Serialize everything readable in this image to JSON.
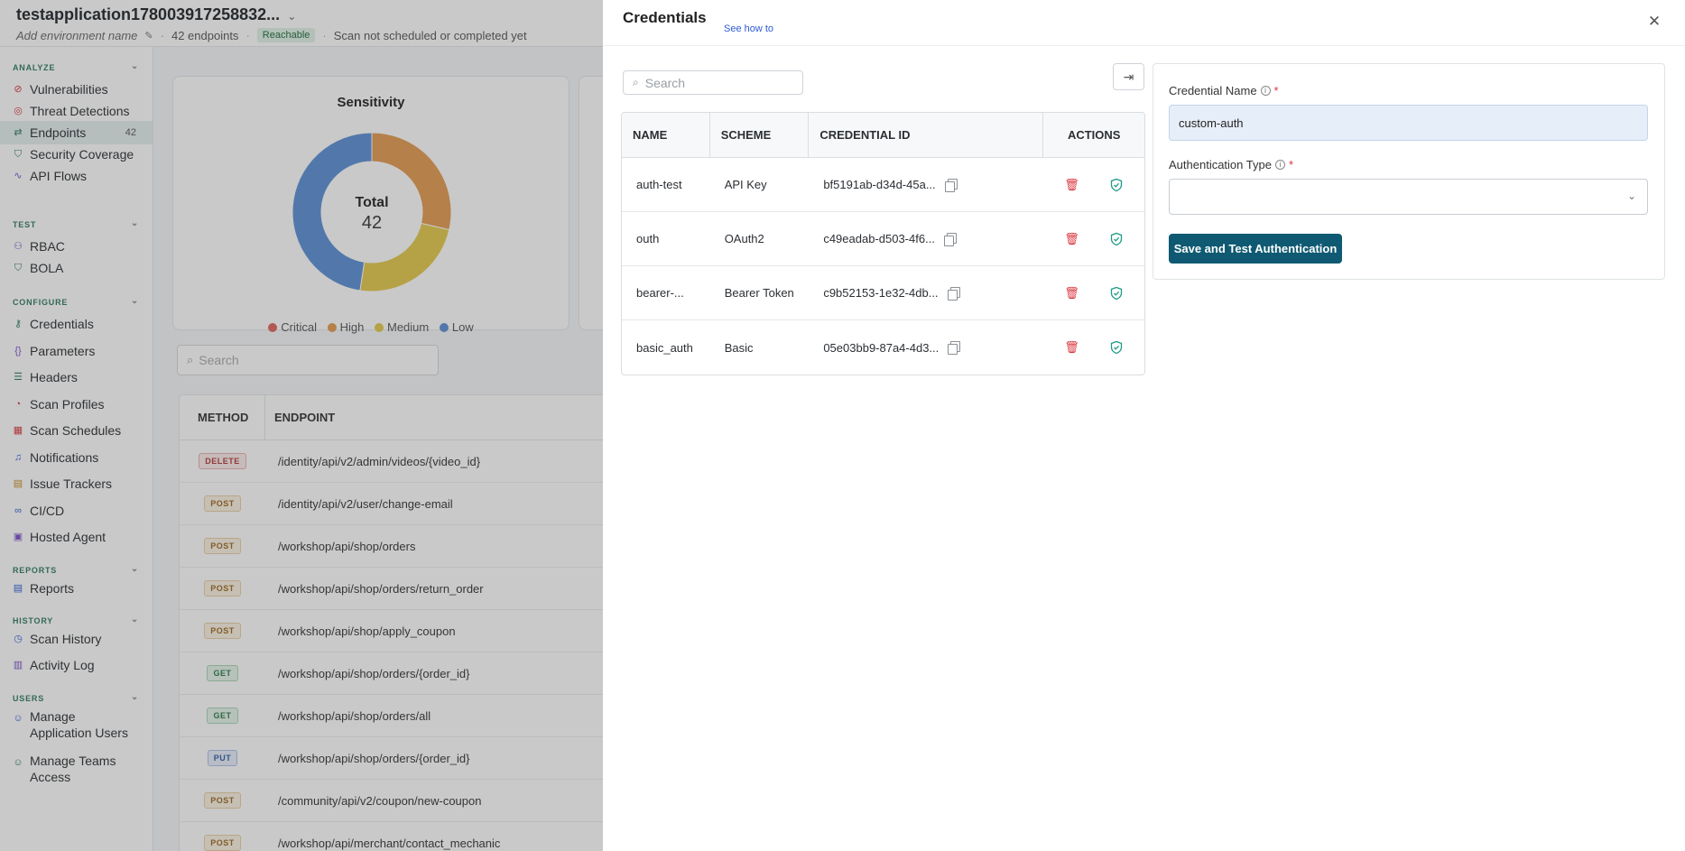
{
  "app": {
    "title": "testapplication178003917258832...",
    "env_placeholder": "Add environment name",
    "endpoints_count": "42 endpoints",
    "reachable": "Reachable",
    "scan_status": "Scan not scheduled or completed yet"
  },
  "sidebar": {
    "sections": [
      {
        "label": "ANALYZE",
        "items": [
          {
            "label": "Vulnerabilities",
            "icon": "bug-icon"
          },
          {
            "label": "Threat Detections",
            "icon": "radar-icon"
          },
          {
            "label": "Endpoints",
            "icon": "endpoints-icon",
            "count": "42",
            "active": true
          },
          {
            "label": "Security Coverage",
            "icon": "shield-icon"
          },
          {
            "label": "API Flows",
            "icon": "flow-icon"
          }
        ]
      },
      {
        "label": "TEST",
        "items": [
          {
            "label": "RBAC",
            "icon": "rbac-icon"
          },
          {
            "label": "BOLA",
            "icon": "bola-icon"
          }
        ]
      },
      {
        "label": "CONFIGURE",
        "items": [
          {
            "label": "Credentials",
            "icon": "key-icon"
          },
          {
            "label": "Parameters",
            "icon": "braces-icon"
          },
          {
            "label": "Headers",
            "icon": "headers-icon"
          },
          {
            "label": "Scan Profiles",
            "icon": "gauge-icon"
          },
          {
            "label": "Scan Schedules",
            "icon": "calendar-icon"
          },
          {
            "label": "Notifications",
            "icon": "bell-icon"
          },
          {
            "label": "Issue Trackers",
            "icon": "tracker-icon"
          },
          {
            "label": "CI/CD",
            "icon": "pipeline-icon"
          },
          {
            "label": "Hosted Agent",
            "icon": "agent-icon"
          }
        ]
      },
      {
        "label": "REPORTS",
        "items": [
          {
            "label": "Reports",
            "icon": "report-icon"
          }
        ]
      },
      {
        "label": "HISTORY",
        "items": [
          {
            "label": "Scan History",
            "icon": "history-icon"
          },
          {
            "label": "Activity Log",
            "icon": "log-icon"
          }
        ]
      },
      {
        "label": "USERS",
        "items": [
          {
            "label": "Manage Application Users",
            "icon": "users-icon"
          },
          {
            "label": "Manage Teams Access",
            "icon": "team-icon"
          }
        ]
      }
    ]
  },
  "sensitivity": {
    "title": "Sensitivity",
    "total_label": "Total",
    "total_value": "42",
    "legend": [
      "Critical",
      "High",
      "Medium",
      "Low"
    ],
    "colors": {
      "Critical": "#e0645c",
      "High": "#e39a50",
      "Medium": "#e3c94a",
      "Low": "#5b8fd6"
    }
  },
  "chart_data": {
    "type": "pie",
    "title": "Sensitivity",
    "categories": [
      "Critical",
      "High",
      "Medium",
      "Low"
    ],
    "values": [
      0,
      12,
      10,
      20
    ]
  },
  "endpoints": {
    "search_placeholder": "Search",
    "headers": [
      "METHOD",
      "ENDPOINT"
    ],
    "rows": [
      {
        "method": "DELETE",
        "path": "/identity/api/v2/admin/videos/{video_id}"
      },
      {
        "method": "POST",
        "path": "/identity/api/v2/user/change-email"
      },
      {
        "method": "POST",
        "path": "/workshop/api/shop/orders"
      },
      {
        "method": "POST",
        "path": "/workshop/api/shop/orders/return_order"
      },
      {
        "method": "POST",
        "path": "/workshop/api/shop/apply_coupon"
      },
      {
        "method": "GET",
        "path": "/workshop/api/shop/orders/{order_id}"
      },
      {
        "method": "GET",
        "path": "/workshop/api/shop/orders/all"
      },
      {
        "method": "PUT",
        "path": "/workshop/api/shop/orders/{order_id}"
      },
      {
        "method": "POST",
        "path": "/community/api/v2/coupon/new-coupon"
      },
      {
        "method": "POST",
        "path": "/workshop/api/merchant/contact_mechanic"
      }
    ]
  },
  "drawer": {
    "title": "Credentials",
    "help_link": "See how to",
    "search_placeholder": "Search",
    "table": {
      "headers": [
        "NAME",
        "SCHEME",
        "CREDENTIAL ID",
        "ACTIONS"
      ],
      "rows": [
        {
          "name": "auth-test",
          "scheme": "API Key",
          "id": "bf5191ab-d34d-45a..."
        },
        {
          "name": "outh",
          "scheme": "OAuth2",
          "id": "c49eadab-d503-4f6..."
        },
        {
          "name": "bearer-...",
          "scheme": "Bearer Token",
          "id": "c9b52153-1e32-4db..."
        },
        {
          "name": "basic_auth",
          "scheme": "Basic",
          "id": "05e03bb9-87a4-4d3..."
        }
      ]
    },
    "form": {
      "name_label": "Credential Name",
      "name_value": "custom-auth",
      "type_label": "Authentication Type",
      "type_value": "",
      "save_label": "Save and Test Authentication",
      "accent": "#0f5a72"
    }
  }
}
